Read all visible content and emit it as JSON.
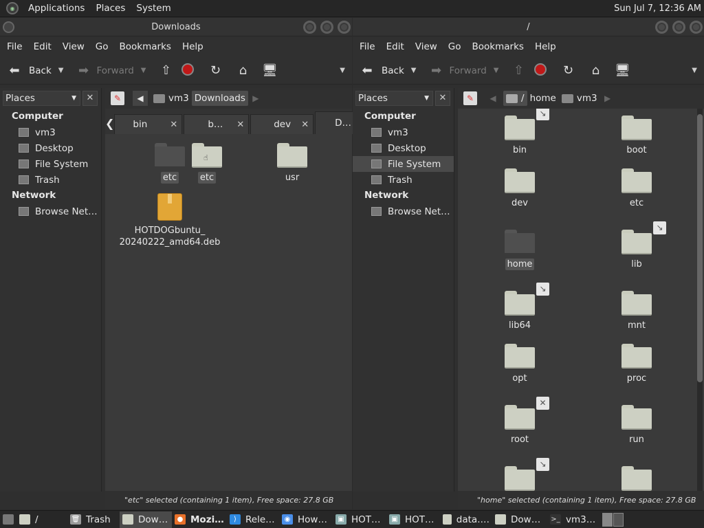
{
  "topbar": {
    "menus": [
      "Applications",
      "Places",
      "System"
    ],
    "clock": "Sun Jul  7, 12:36 AM"
  },
  "left": {
    "title": "Downloads",
    "menus": [
      "File",
      "Edit",
      "View",
      "Go",
      "Bookmarks",
      "Help"
    ],
    "toolbar": {
      "back": "Back",
      "forward": "Forward"
    },
    "sidebar": {
      "selector": "Places",
      "computer_header": "Computer",
      "items": [
        "vm3",
        "Desktop",
        "File System",
        "Trash"
      ],
      "network_header": "Network",
      "network_items": [
        "Browse Net…"
      ]
    },
    "path": [
      "vm3",
      "Downloads"
    ],
    "tabs": [
      "bin",
      "b…",
      "dev",
      "D…"
    ],
    "files": [
      {
        "name": "etc",
        "kind": "folder-dark"
      },
      {
        "name": "etc",
        "kind": "folder-drag"
      },
      {
        "name": "usr",
        "kind": "folder"
      },
      {
        "name": "HOTDOGbuntu_\n20240222_amd64.deb",
        "kind": "package"
      }
    ],
    "status": "\"etc\" selected (containing 1 item), Free space: 27.8 GB"
  },
  "right": {
    "title": "/",
    "menus": [
      "File",
      "Edit",
      "View",
      "Go",
      "Bookmarks",
      "Help"
    ],
    "toolbar": {
      "back": "Back",
      "forward": "Forward"
    },
    "sidebar": {
      "selector": "Places",
      "computer_header": "Computer",
      "items": [
        "vm3",
        "Desktop",
        "File System",
        "Trash"
      ],
      "network_header": "Network",
      "network_items": [
        "Browse Net…"
      ]
    },
    "path": [
      "/",
      "home",
      "vm3"
    ],
    "files": [
      {
        "name": "bin",
        "emblem": "link"
      },
      {
        "name": "boot",
        "emblem": ""
      },
      {
        "name": "dev",
        "emblem": ""
      },
      {
        "name": "etc",
        "emblem": ""
      },
      {
        "name": "home",
        "emblem": "",
        "selected": true
      },
      {
        "name": "lib",
        "emblem": "link"
      },
      {
        "name": "lib64",
        "emblem": "link"
      },
      {
        "name": "mnt",
        "emblem": ""
      },
      {
        "name": "opt",
        "emblem": ""
      },
      {
        "name": "proc",
        "emblem": ""
      },
      {
        "name": "root",
        "emblem": "locked"
      },
      {
        "name": "run",
        "emblem": ""
      },
      {
        "name": "",
        "emblem": "link"
      },
      {
        "name": "",
        "emblem": ""
      }
    ],
    "status": "\"home\" selected (containing 1 item), Free space: 27.8 GB"
  },
  "taskbar": {
    "items": [
      {
        "label": "/",
        "icon": "folder-icon"
      },
      {
        "label": "Trash",
        "icon": "trash-icon"
      },
      {
        "label": "Dow…",
        "icon": "folder-icon",
        "active": true
      },
      {
        "label": "Mozi…",
        "icon": "firefox-icon"
      },
      {
        "label": "Rele…",
        "icon": "vscode-icon"
      },
      {
        "label": "How…",
        "icon": "chrome-icon"
      },
      {
        "label": "HOT…",
        "icon": "installer-icon"
      },
      {
        "label": "HOT…",
        "icon": "installer-icon"
      },
      {
        "label": "data.…",
        "icon": "folder-icon"
      },
      {
        "label": "Dow…",
        "icon": "folder-icon"
      },
      {
        "label": "vm3…",
        "icon": "terminal-icon"
      }
    ]
  },
  "colors": {
    "accent": "#4d4d4d",
    "stop": "#c01818",
    "folder": "#cdd0c3",
    "package": "#e2a636"
  }
}
